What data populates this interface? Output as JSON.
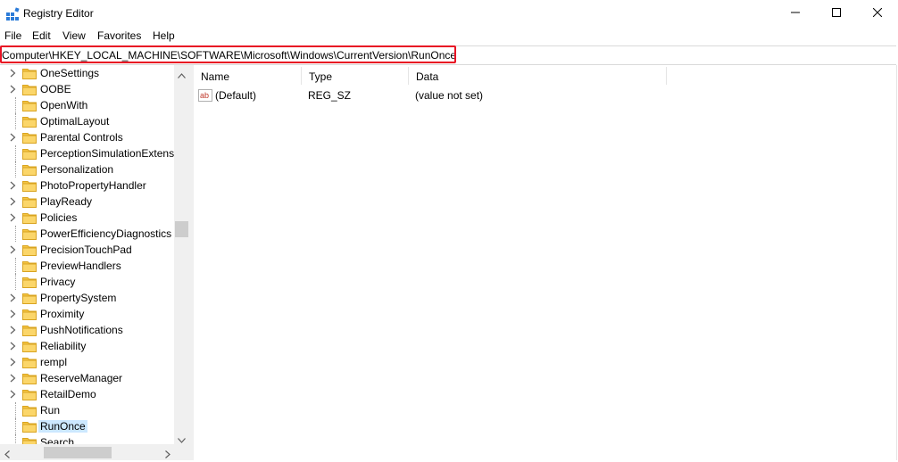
{
  "window": {
    "title": "Registry Editor",
    "controls": {
      "minimize": "minimize-icon",
      "maximize": "maximize-icon",
      "close": "close-icon"
    }
  },
  "menu": [
    "File",
    "Edit",
    "View",
    "Favorites",
    "Help"
  ],
  "address": {
    "path": "Computer\\HKEY_LOCAL_MACHINE\\SOFTWARE\\Microsoft\\Windows\\CurrentVersion\\RunOnce",
    "highlight_color": "#e81123"
  },
  "tree": {
    "items": [
      {
        "label": "OneSettings",
        "expandable": true
      },
      {
        "label": "OOBE",
        "expandable": true
      },
      {
        "label": "OpenWith",
        "expandable": false
      },
      {
        "label": "OptimalLayout",
        "expandable": false
      },
      {
        "label": "Parental Controls",
        "expandable": true
      },
      {
        "label": "PerceptionSimulationExtens",
        "expandable": false
      },
      {
        "label": "Personalization",
        "expandable": false
      },
      {
        "label": "PhotoPropertyHandler",
        "expandable": true
      },
      {
        "label": "PlayReady",
        "expandable": true
      },
      {
        "label": "Policies",
        "expandable": true
      },
      {
        "label": "PowerEfficiencyDiagnostics",
        "expandable": false
      },
      {
        "label": "PrecisionTouchPad",
        "expandable": true
      },
      {
        "label": "PreviewHandlers",
        "expandable": false
      },
      {
        "label": "Privacy",
        "expandable": false
      },
      {
        "label": "PropertySystem",
        "expandable": true
      },
      {
        "label": "Proximity",
        "expandable": true
      },
      {
        "label": "PushNotifications",
        "expandable": true
      },
      {
        "label": "Reliability",
        "expandable": true
      },
      {
        "label": "rempl",
        "expandable": true
      },
      {
        "label": "ReserveManager",
        "expandable": true
      },
      {
        "label": "RetailDemo",
        "expandable": true
      },
      {
        "label": "Run",
        "expandable": false
      },
      {
        "label": "RunOnce",
        "expandable": false,
        "selected": true
      },
      {
        "label": "Search",
        "expandable": false
      }
    ]
  },
  "list": {
    "columns": [
      "Name",
      "Type",
      "Data"
    ],
    "rows": [
      {
        "name": "(Default)",
        "type": "REG_SZ",
        "data": "(value not set)",
        "icon": "string-value-icon"
      }
    ]
  },
  "colors": {
    "folder": "#f5c542",
    "selection": "#cce8ff",
    "app_icon": "#2b7bd8"
  }
}
